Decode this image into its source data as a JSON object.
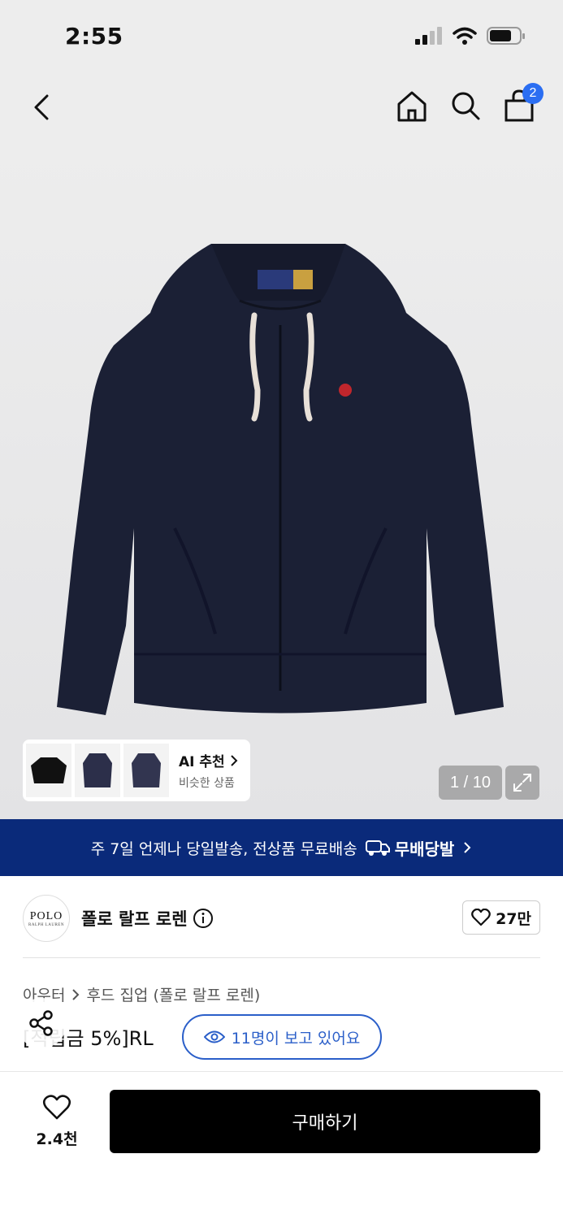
{
  "status": {
    "time": "2:55"
  },
  "nav": {
    "cart_count": "2"
  },
  "gallery": {
    "ai_title": "AI 추천",
    "ai_subtitle": "비슷한 상품",
    "counter": "1 / 10"
  },
  "promo": {
    "text": "주 7일 언제나 당일발송, 전상품 무료배송",
    "badge": "무배당발"
  },
  "brand": {
    "logo_main": "POLO",
    "logo_small": "RALPH LAUREN",
    "name": "폴로 랄프 로렌",
    "likes": "27만"
  },
  "product": {
    "breadcrumb": [
      "아우터",
      "후드 집업 (폴로 랄프 로렌)"
    ],
    "title": "[적립금 5%]RL",
    "viewers": "11명이 보고 있어요"
  },
  "bottom": {
    "wish_count": "2.4천",
    "buy_label": "구매하기"
  }
}
